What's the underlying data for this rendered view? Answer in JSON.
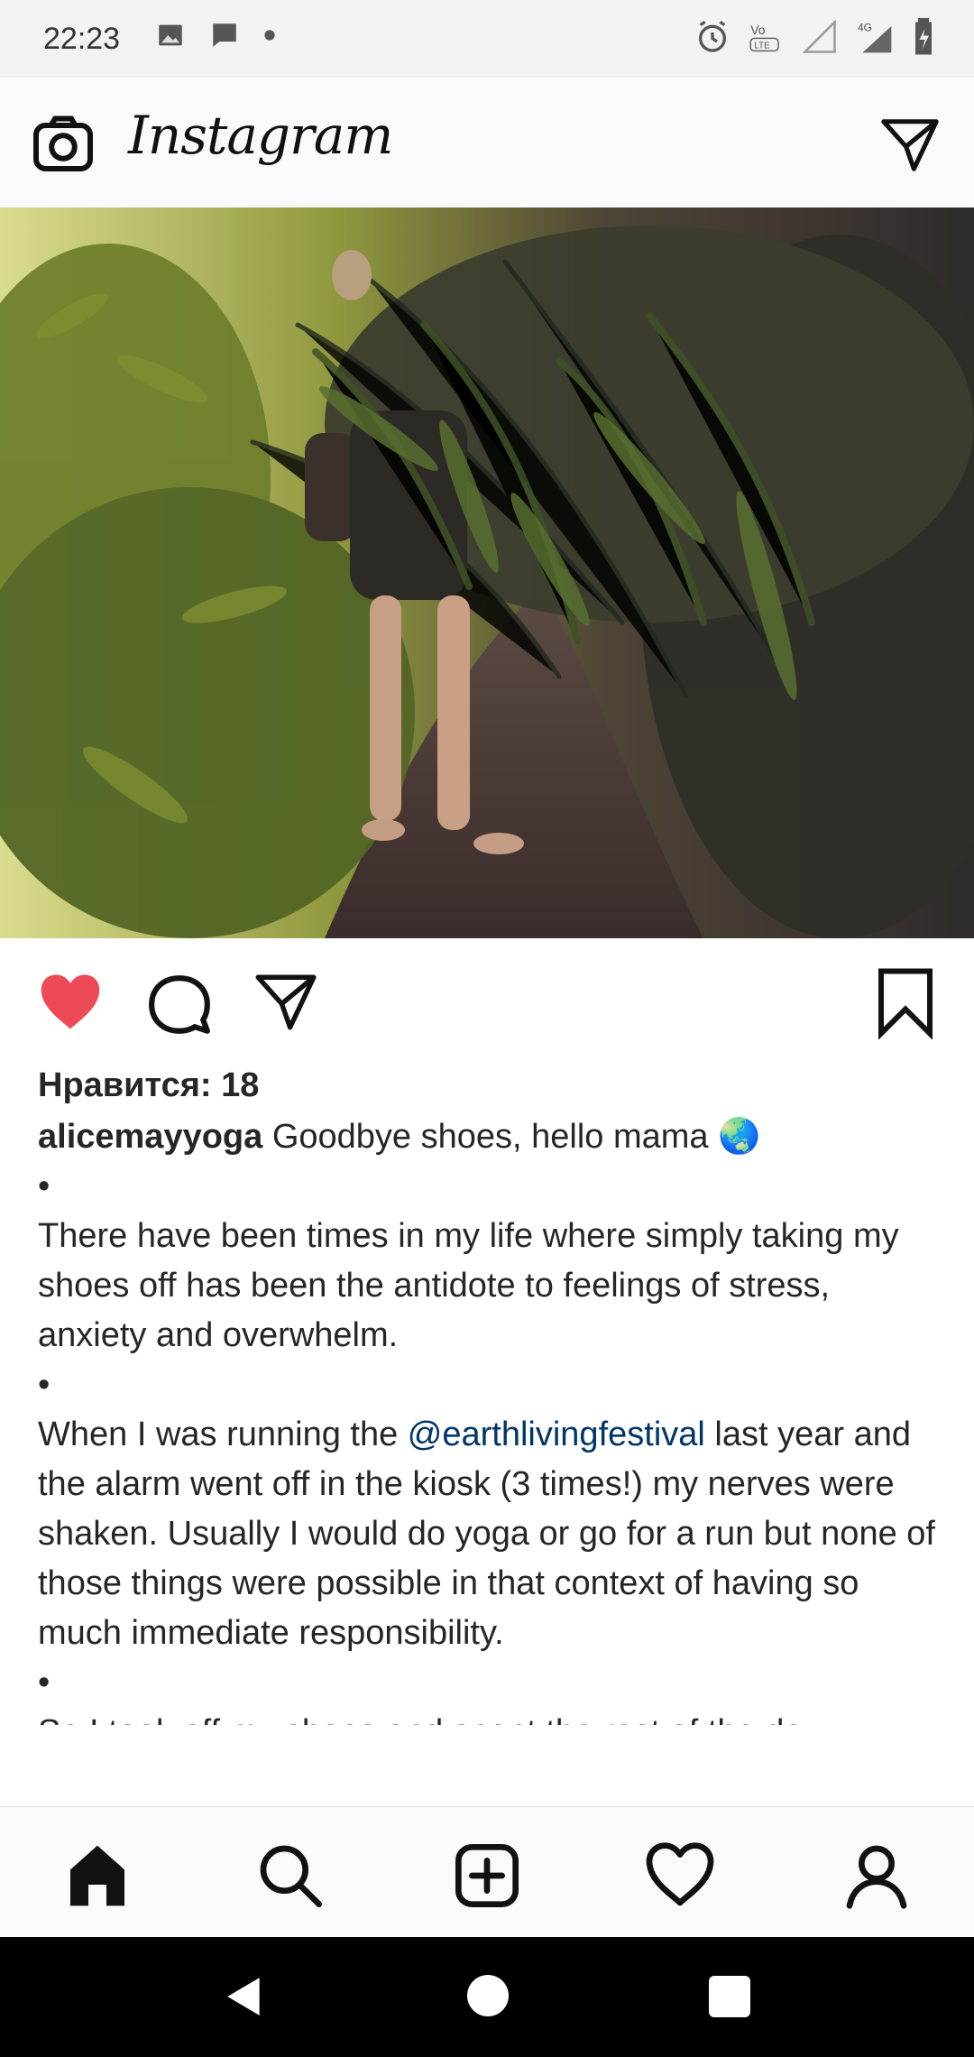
{
  "status_bar": {
    "time": "22:23",
    "left_icons": [
      "image-icon",
      "message-icon",
      "dot-icon"
    ],
    "right_icons": [
      "alarm-icon",
      "volte-icon",
      "signal-icon",
      "4g-signal-icon",
      "battery-icon"
    ]
  },
  "app_bar": {
    "title": "Instagram",
    "left_icon": "camera-icon",
    "right_icon": "direct-message-icon"
  },
  "post": {
    "likes_text": "Нравится: 18",
    "username": "alicemayyoga",
    "caption_first_line": "Goodbye shoes, hello mama 🌏",
    "bullet": "•",
    "paragraph_1": "There have been times in my life where simply taking my shoes off has been the antidote to feelings of stress, anxiety and overwhelm.",
    "paragraph_2_before_mention": "When I was running the ",
    "mention": "@earthlivingfestival",
    "paragraph_2_after_mention": " last year and the alarm went off in the kiosk (3 times!) my nerves were shaken. Usually I would do yoga or go for a run but none of those things were possible in that context of having so much immediate responsibility.",
    "paragraph_3": "So I took off my shoes and spent the rest of the day barefoot. It was so calming, perhaps because I was",
    "actions": [
      "heart-icon",
      "comment-icon",
      "share-icon",
      "bookmark-icon"
    ],
    "liked": true
  },
  "bottom_nav": {
    "items": [
      "home-icon",
      "search-icon",
      "add-icon",
      "activity-icon",
      "profile-icon"
    ]
  },
  "system_nav": {
    "items": [
      "back-icon",
      "home-circle-icon",
      "recents-icon"
    ]
  },
  "colors": {
    "heart": "#ed4956",
    "mention": "#003569",
    "text": "#262626"
  }
}
